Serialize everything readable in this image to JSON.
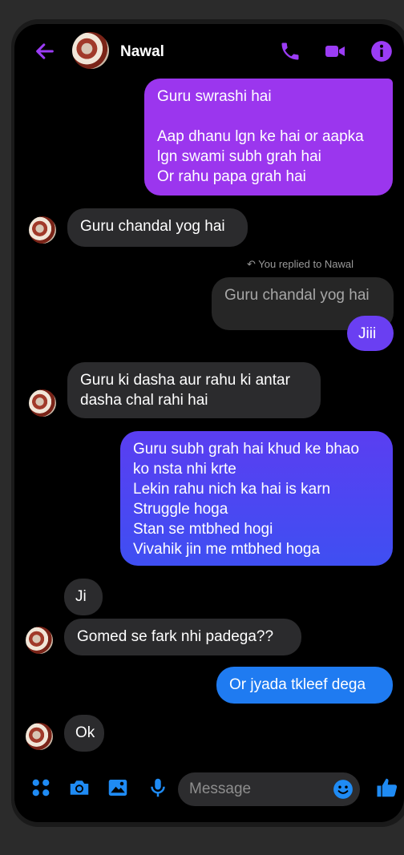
{
  "header": {
    "contact_name": "Nawal"
  },
  "messages": {
    "m1": "Guru swrashi hai\n\nAap dhanu lgn ke hai or aapka\nlgn swami subh grah hai\nOr rahu papa grah hai",
    "m2": "Guru chandal yog hai",
    "reply_label": "You replied to Nawal",
    "reply_quote": "Guru chandal yog hai",
    "m3": "Jiii",
    "m4": "Guru ki dasha aur rahu ki antar\ndasha chal rahi hai",
    "m5": "Guru subh grah hai khud ke bhao\nko nsta nhi krte\nLekin rahu nich ka hai is karn\nStruggle hoga\nStan se mtbhed hogi\nVivahik jin me mtbhed hoga",
    "m6": "Ji",
    "m7": "Gomed se fark nhi padega??",
    "m8": "Or jyada tkleef dega",
    "m9": "Ok"
  },
  "composer": {
    "placeholder": "Message"
  },
  "colors": {
    "accent": "#9b3cf5",
    "purple_bubble": "#9b36ee",
    "indigo_bubble": "#5b3df0",
    "blue_bubble": "#1f7bf1"
  },
  "icons": [
    "back-arrow-icon",
    "phone-icon",
    "video-icon",
    "info-icon",
    "apps-icon",
    "camera-icon",
    "gallery-icon",
    "mic-icon",
    "emoji-icon",
    "thumbs-up-icon"
  ]
}
